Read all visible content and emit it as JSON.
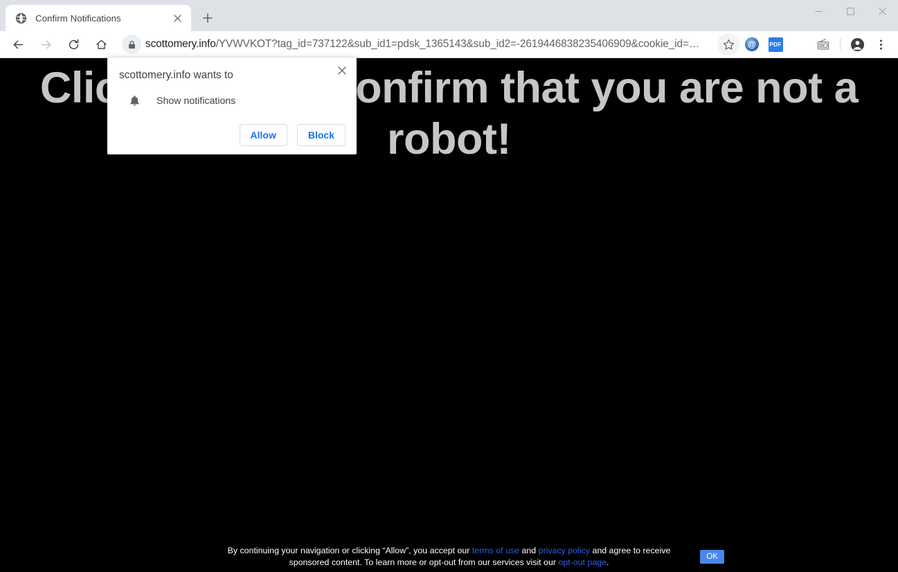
{
  "window": {
    "controls": {
      "minimize": "minimize",
      "maximize": "maximize",
      "close": "close"
    }
  },
  "tabstrip": {
    "tabs": [
      {
        "title": "Confirm Notifications",
        "favicon": "globe-icon",
        "close_label": "×"
      }
    ],
    "new_tab_label": "+"
  },
  "toolbar": {
    "back": "back-arrow-icon",
    "forward": "forward-arrow-icon",
    "reload": "reload-icon",
    "home": "home-icon",
    "lock": "lock-icon",
    "url_domain": "scottomery.info",
    "url_path": "/YVWVKOT?tag_id=737122&sub_id1=pdsk_1365143&sub_id2=-2619446838235406909&cookie_id=…",
    "url_full": "scottomery.info/YVWVKOT?tag_id=737122&sub_id1=pdsk_1365143&sub_id2=-2619446838235406909&cookie_id=…",
    "bookmark": "star-icon",
    "extension_at_label": "@",
    "extension_pdf_label": "PDF",
    "media_icon": "radio-icon",
    "profile": "avatar-icon",
    "menu": "three-dot-menu-icon"
  },
  "page": {
    "headline": "Click Allow to confirm that you are not a robot!",
    "background_color": "#000000",
    "headline_color": "#c6c6c6"
  },
  "permission_dialog": {
    "title": "scottomery.info wants to",
    "close_label": "×",
    "permission_icon": "bell-icon",
    "permission_label": "Show notifications",
    "allow_label": "Allow",
    "block_label": "Block",
    "accent_color": "#1a73e8"
  },
  "consent_bar": {
    "text_part_1": "By continuing your navigation or clicking “Allow”, you accept our ",
    "link_terms": "terms of use",
    "text_part_2": " and ",
    "link_privacy": "privacy policy",
    "text_part_3": " and agree to receive sponsored content. To learn more or opt-out from our services visit our ",
    "link_optout": "opt-out page",
    "text_part_4": ".",
    "ok_label": "OK",
    "ok_color": "#4a86e8",
    "link_color": "#2b5fe8"
  }
}
